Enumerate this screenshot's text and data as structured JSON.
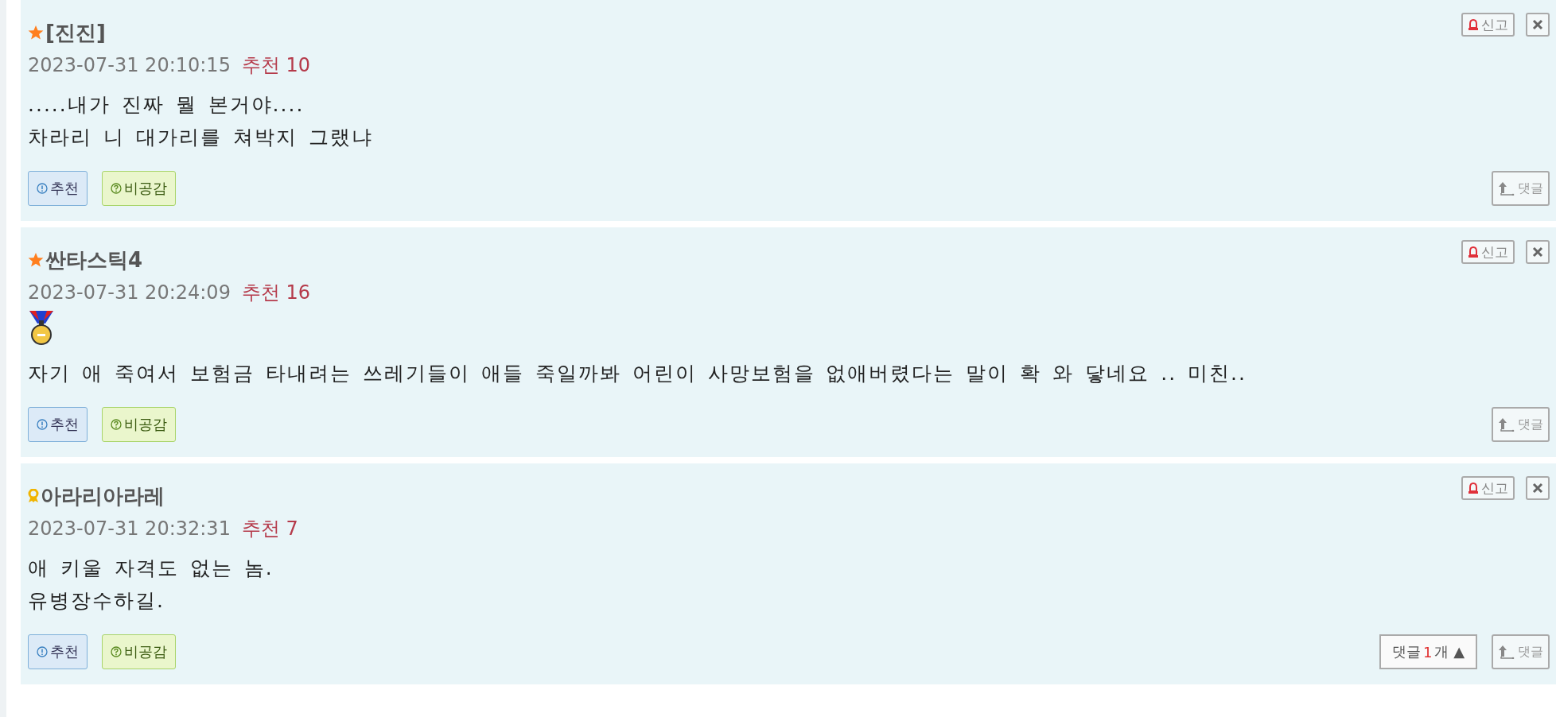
{
  "comments": [
    {
      "kind": "star",
      "author": "[진진]",
      "date": "2023-07-31 20:10:15",
      "likes": "추천 10",
      "medal": false,
      "body": [
        ".....내가 진짜 뭘 본거야....",
        "차라리 니 대가리를 쳐박지 그랬냐"
      ],
      "recommend": "추천",
      "disagree": "비공감",
      "report": "신고",
      "reply": "댓글"
    },
    {
      "kind": "star",
      "author": "싼타스틱4",
      "date": "2023-07-31 20:24:09",
      "likes": "추천 16",
      "medal": true,
      "body": [
        "자기 애 죽여서 보험금 타내려는 쓰레기들이 애들 죽일까봐 어린이 사망보험을 없애버렸다는 말이 확 와 닿네요 .. 미친.."
      ],
      "recommend": "추천",
      "disagree": "비공감",
      "report": "신고",
      "reply": "댓글"
    },
    {
      "kind": "ribbon",
      "author": "아라리아라레",
      "date": "2023-07-31 20:32:31",
      "likes": "추천 7",
      "medal": false,
      "body": [
        "애 키울 자격도 없는 놈.",
        "유병장수하길."
      ],
      "recommend": "추천",
      "disagree": "비공감",
      "report": "신고",
      "reply": "댓글",
      "replies": {
        "label": "댓글",
        "count": "1",
        "unit": "개",
        "arrow": "▲"
      }
    }
  ]
}
